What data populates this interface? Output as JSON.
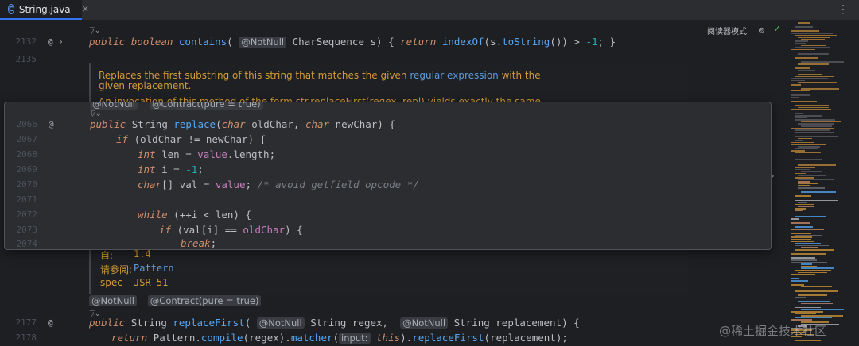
{
  "tab": {
    "filename": "String.java",
    "icon": "C",
    "close": "✕",
    "more": "⋮"
  },
  "toolbar": {
    "reader_mode": "阅读器模式"
  },
  "lines": {
    "l2132": "2132",
    "l2135": "2135",
    "l2066": "2066",
    "l2067": "2067",
    "l2068": "2068",
    "l2069": "2069",
    "l2070": "2070",
    "l2071": "2071",
    "l2072": "2072",
    "l2073": "2073",
    "l2074": "2074",
    "l2177": "2177",
    "l2178": "2178"
  },
  "hints": {
    "usage": "ঢ়⌄"
  },
  "code": {
    "contains": {
      "public": "public",
      "boolean": "boolean",
      "name": "contains",
      "open": "(",
      "ann": "@NotNull",
      "type": "CharSequence",
      "param": "s",
      "close": ")",
      "lbrace": "{",
      "ret": "return",
      "call": "indexOf",
      "arg": "(s.",
      "tostr": "toString",
      "rest": "()) > ",
      "num": "-1",
      "semi": ";",
      "rbrace": "}"
    },
    "peek_annotations": {
      "notnull": "@NotNull",
      "contract": "@Contract(pure = true)"
    },
    "replace_sig": {
      "public": "public",
      "type": "String",
      "name": "replace",
      "p1t": "char",
      "p1": "oldChar",
      "p2t": "char",
      "p2": "newChar"
    },
    "if1": {
      "kw": "if",
      "cond": "(oldChar != newChar) {"
    },
    "len": {
      "type": "int",
      "rest": "len = ",
      "fld": "value",
      "tail": ".length;"
    },
    "i": {
      "type": "int",
      "rest": "i = ",
      "num": "-1",
      "tail": ";"
    },
    "val": {
      "type": "char",
      "rest": "[] val = ",
      "fld": "value",
      "tail": "; ",
      "comment": "/* avoid getfield opcode */"
    },
    "while": {
      "kw": "while",
      "cond": "(++i < len) {"
    },
    "if2": {
      "kw": "if",
      "cond": "(val[i] == ",
      "fld": "oldChar",
      "tail": ") {"
    },
    "brk": {
      "kw": "break",
      "tail": ";"
    },
    "rf_annotations": {
      "notnull": "@NotNull",
      "contract": "@Contract(pure = true)"
    },
    "replace_first": {
      "public": "public",
      "type": "String",
      "name": "replaceFirst",
      "open": "(",
      "ann1": "@NotNull",
      "p1t": "String",
      "p1": "regex,",
      "ann2": "@NotNull",
      "p2t": "String",
      "p2": "replacement) {"
    },
    "ret_line": {
      "ret": "return",
      "cls": "Pattern.",
      "compile": "compile",
      "mid": "(regex).",
      "matcher": "matcher",
      "open": "(",
      "pill": "input:",
      "this": "this",
      "close": ").",
      "rf": "replaceFirst",
      "tail": "(replacement);"
    }
  },
  "doc": {
    "line1a": "Replaces the first substring of this string that matches the given ",
    "line1link": "regular expression",
    "line1b": " with the",
    "line2": "given replacement.",
    "line3": "An invocation of this method of the form str.replaceFirst(regex, repl) yields exactly the same",
    "since_tag": "自:",
    "since_val": "1.4",
    "see_tag": "请参阅:",
    "see_val": "Pattern",
    "spec_tag": "spec",
    "spec_val": "JSR-51"
  },
  "watermark": "@稀土掘金技术社区",
  "colors": {
    "accent": "#3574f0",
    "keyword": "#cf8e6d",
    "function": "#56a8f5",
    "number": "#2aacb8",
    "field": "#c77dbb",
    "doc": "#d19a38",
    "link": "#5e9ad9",
    "check": "#5fb865"
  }
}
